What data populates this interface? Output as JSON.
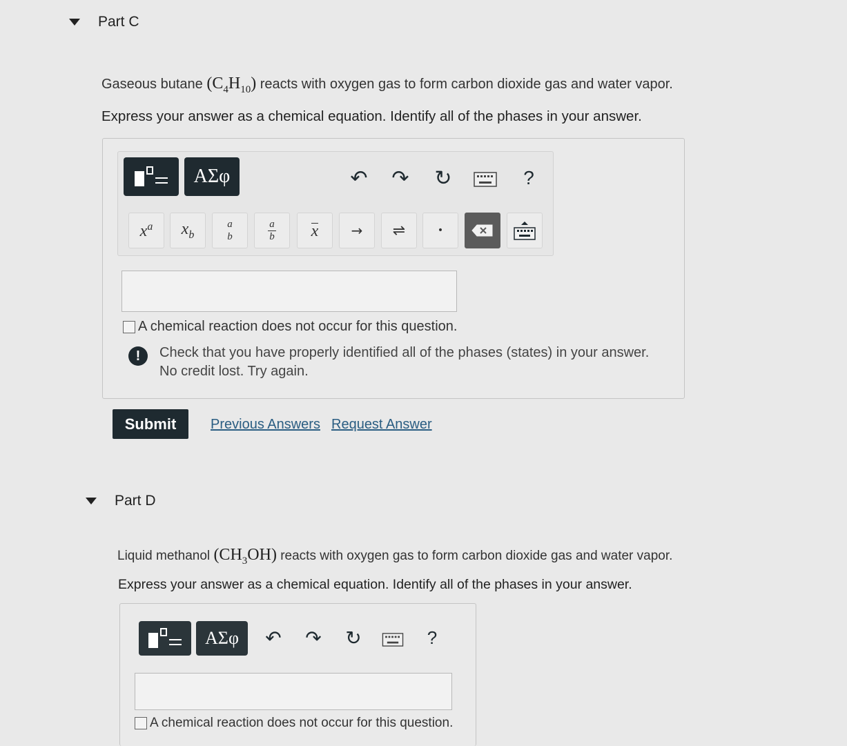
{
  "part_c": {
    "title": "Part C",
    "question_prefix": "Gaseous butane",
    "formula_open": "(C",
    "formula_sub1": "4",
    "formula_mid": "H",
    "formula_sub2": "10",
    "formula_close": ")",
    "question_suffix": "reacts with oxygen gas to form carbon dioxide gas and water vapor.",
    "instruction": "Express your answer as a chemical equation. Identify all of the phases in your answer.",
    "toolbar": {
      "greek_label": "ΑΣφ",
      "undo_glyph": "↶",
      "redo_glyph": "↷",
      "reset_glyph": "↻",
      "help_label": "?"
    },
    "keys": {
      "superscript_base": "x",
      "superscript_exp": "a",
      "subscript_base": "x",
      "subscript_sub": "b",
      "fraction_num": "a",
      "fraction_den": "b",
      "mixed_num": "a",
      "mixed_den": "b",
      "overline": "x",
      "arrow": "→",
      "equilibrium": "⇌",
      "dot": "•"
    },
    "answer_value": "",
    "no_reaction_label": "A chemical reaction does not occur for this question.",
    "feedback_line1": "Check that you have properly identified all of the phases (states) in your answer.",
    "feedback_line2": "No credit lost. Try again.",
    "feedback_icon": "!",
    "submit_label": "Submit",
    "previous_answers_label": "Previous Answers",
    "request_answer_label": "Request Answer"
  },
  "part_d": {
    "title": "Part D",
    "question_prefix": "Liquid methanol",
    "formula_open": "(CH",
    "formula_sub1": "3",
    "formula_close": "OH)",
    "question_suffix": "reacts with oxygen gas to form carbon dioxide gas and water vapor.",
    "instruction": "Express your answer as a chemical equation. Identify all of the phases in your answer.",
    "toolbar": {
      "greek_label": "ΑΣφ",
      "undo_glyph": "↶",
      "redo_glyph": "↷",
      "reset_glyph": "↻",
      "help_label": "?"
    },
    "answer_value": "",
    "no_reaction_label": "A chemical reaction does not occur for this question."
  },
  "icons": [
    "collapse-triangle-icon",
    "templates-icon",
    "undo-icon",
    "redo-icon",
    "reset-icon",
    "keyboard-icon",
    "help-icon",
    "backspace-icon",
    "keyboard-toggle-icon",
    "warning-icon"
  ]
}
